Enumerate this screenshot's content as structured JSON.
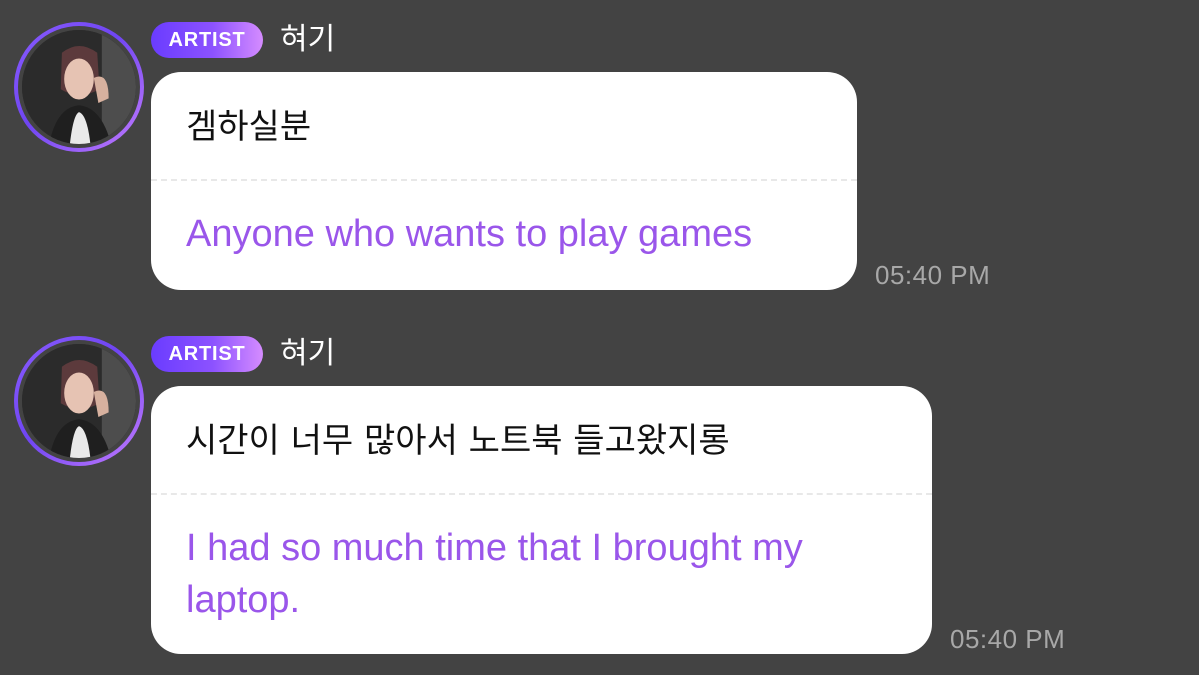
{
  "messages": [
    {
      "badge": "ARTIST",
      "username": "혀기",
      "original": "겜하실분",
      "translation": "Anyone who wants to play games",
      "time": "05:40 PM",
      "avatar": "profile-photo"
    },
    {
      "badge": "ARTIST",
      "username": "혀기",
      "original": "시간이 너무 많아서 노트북 들고왔지롱",
      "translation": "I had so much time that I brought my laptop.",
      "time": "05:40 PM",
      "avatar": "profile-photo"
    }
  ],
  "colors": {
    "background": "#434343",
    "bubble": "#ffffff",
    "translation_text": "#9a56ea",
    "badge_gradient_start": "#6a3cff",
    "badge_gradient_end": "#d58cff",
    "timestamp": "#a8a8a8"
  }
}
